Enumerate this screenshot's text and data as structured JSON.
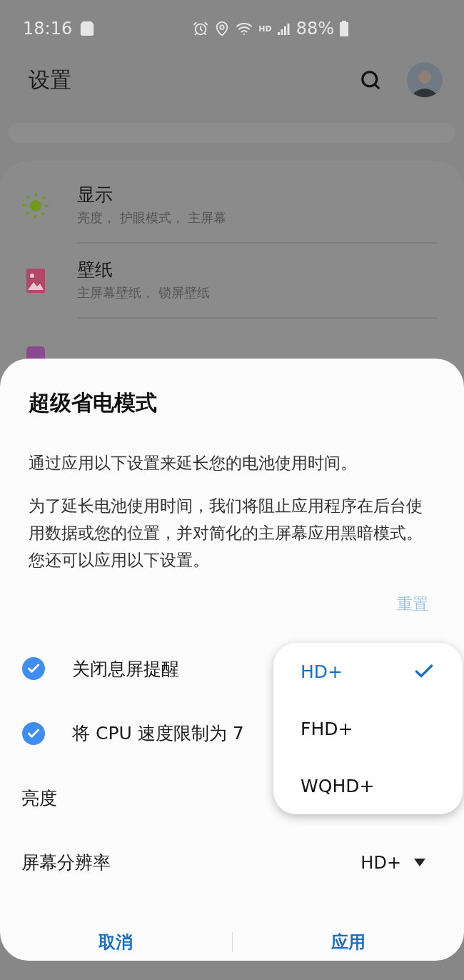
{
  "status_bar": {
    "time": "18:16",
    "network_badge": "HD",
    "battery": "88%"
  },
  "header": {
    "title": "设置"
  },
  "settings": [
    {
      "kind": "display",
      "title": "显示",
      "subtitle": "亮度， 护眼模式， 主屏幕"
    },
    {
      "kind": "wallpaper",
      "title": "壁纸",
      "subtitle": "主屏幕壁纸， 锁屏壁纸"
    },
    {
      "kind": "theme"
    }
  ],
  "dialog": {
    "title": "超级省电模式",
    "paragraphs": [
      "通过应用以下设置来延长您的电池使用时间。",
      "为了延长电池使用时间，我们将阻止应用程序在后台使用数据或您的位置，并对简化的主屏幕应用黑暗模式。您还可以应用以下设置。"
    ],
    "reset": {
      "label": "重置",
      "disabled": true
    },
    "options": [
      {
        "kind": "check",
        "label": "关闭息屏提醒",
        "checked": true
      },
      {
        "kind": "check",
        "label": "将 CPU 速度限制为 7",
        "checked": true
      },
      {
        "kind": "plain",
        "label": "亮度"
      },
      {
        "kind": "select",
        "label": "屏幕分辨率",
        "value": "HD+"
      }
    ],
    "menu": [
      {
        "label": "HD+",
        "selected": true
      },
      {
        "label": "FHD+",
        "selected": false
      },
      {
        "label": "WQHD+",
        "selected": false
      }
    ],
    "buttons": [
      "取消",
      "应用"
    ]
  }
}
